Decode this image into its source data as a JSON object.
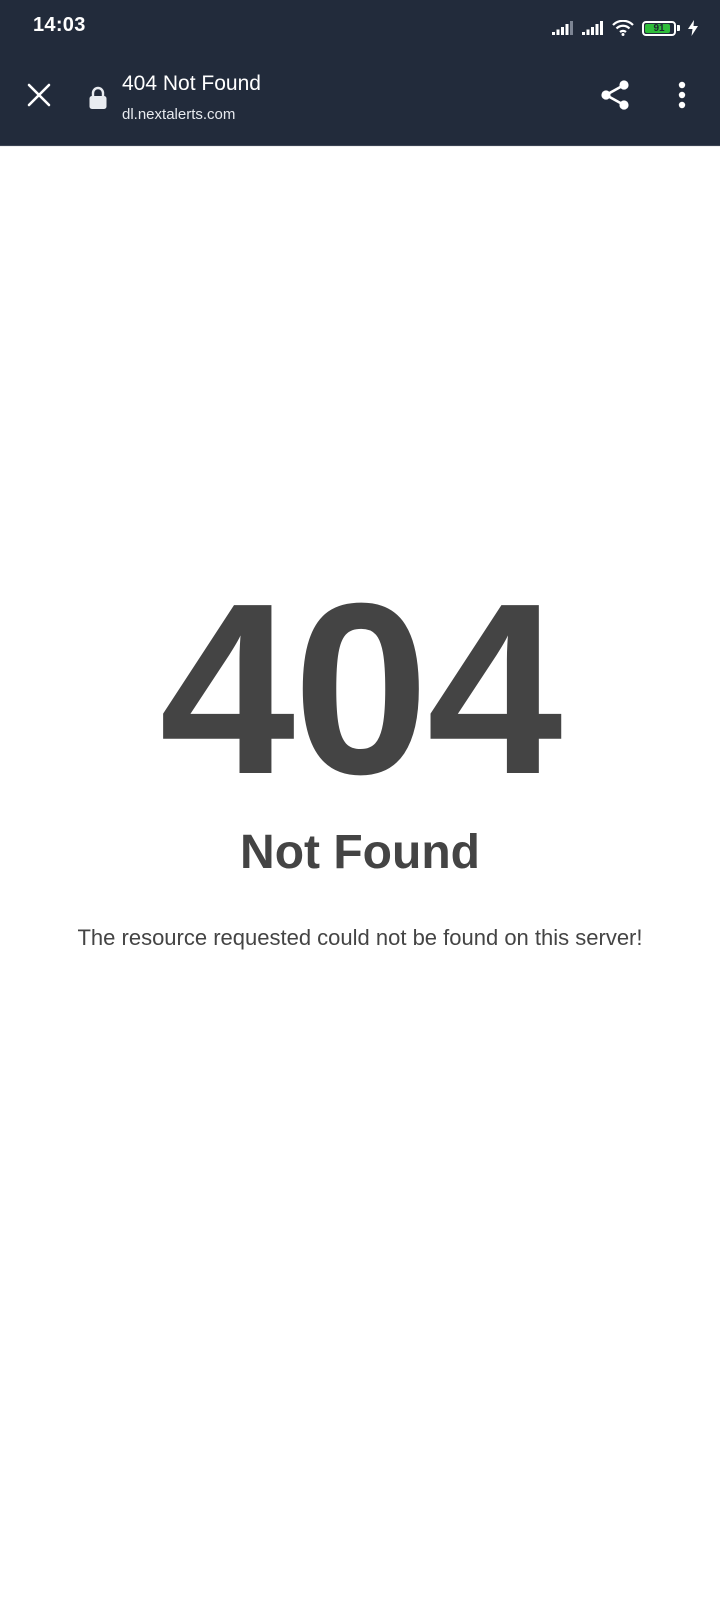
{
  "status_bar": {
    "time": "14:03",
    "battery_level": "91",
    "icons": [
      "signal-bars-icon",
      "signal-bars-icon",
      "wifi-icon",
      "battery-icon",
      "charging-bolt-icon"
    ]
  },
  "browser": {
    "page_title": "404 Not Found",
    "url": "dl.nextalerts.com",
    "icons": [
      "close-icon",
      "lock-icon",
      "share-icon",
      "more-vertical-icon"
    ]
  },
  "page": {
    "error_code": "404",
    "heading": "Not Found",
    "message": "The resource requested could not be found on this server!"
  },
  "colors": {
    "toolbar_bg": "#222b3b",
    "text_dark": "#444444",
    "battery_green": "#2fbd3a"
  }
}
